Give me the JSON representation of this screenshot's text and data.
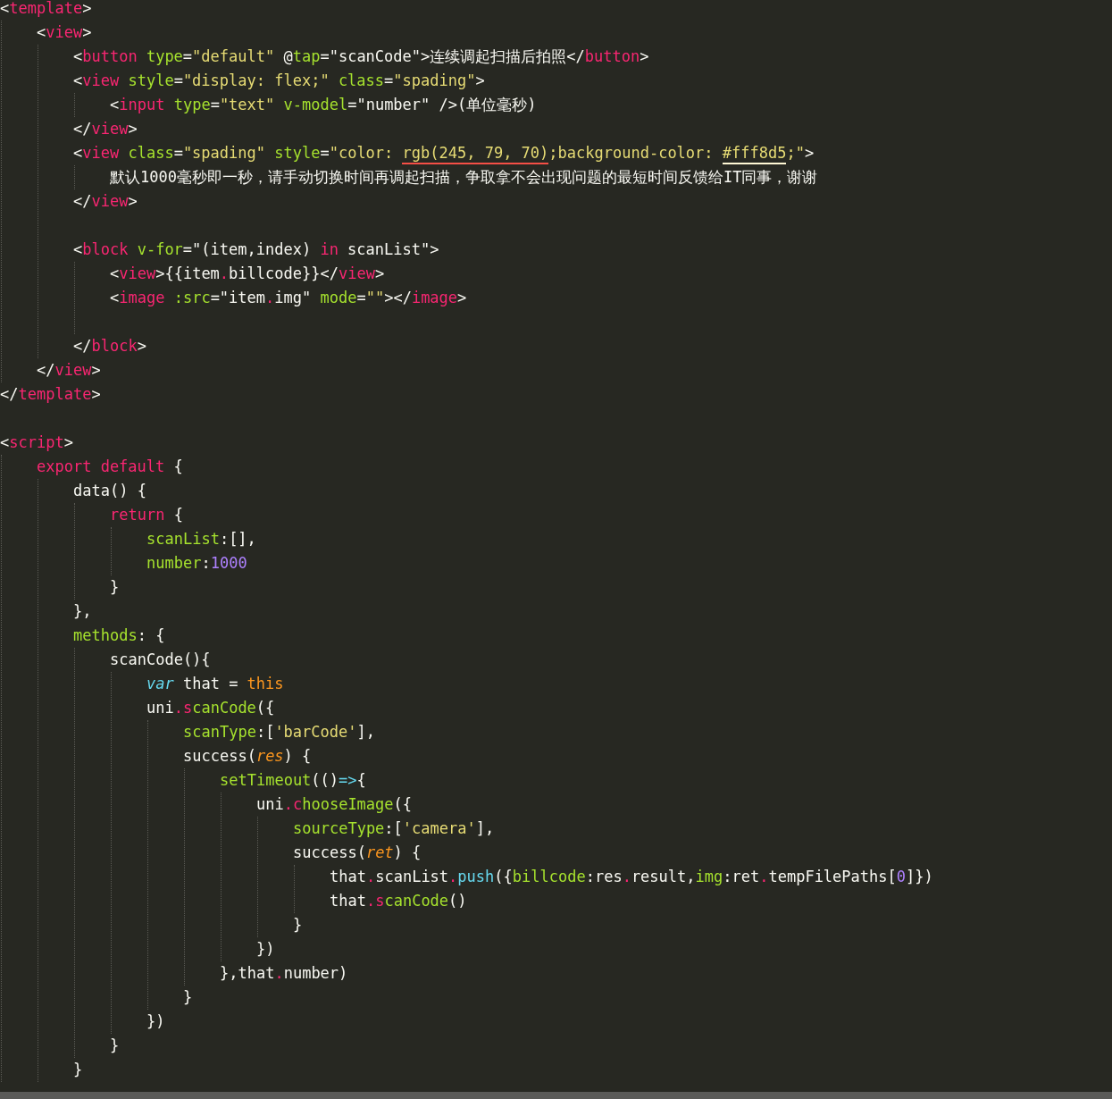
{
  "editor": {
    "lines": [
      {
        "kind": "code",
        "tokens": [
          {
            "kind": "punct",
            "text": "<"
          },
          {
            "kind": "tag",
            "text": "template"
          },
          {
            "kind": "punct",
            "text": ">"
          }
        ],
        "children": [
          {
            "kind": "code",
            "tokens": [
              {
                "kind": "punct",
                "text": "<"
              },
              {
                "kind": "tag",
                "text": "view"
              },
              {
                "kind": "punct",
                "text": ">"
              }
            ],
            "children": [
              {
                "kind": "code",
                "tokens": [
                  {
                    "kind": "punct",
                    "text": "<"
                  },
                  {
                    "kind": "tag",
                    "text": "button"
                  },
                  {
                    "kind": "attr",
                    "text": " type"
                  },
                  {
                    "kind": "punct",
                    "text": "="
                  },
                  {
                    "kind": "string",
                    "text": "\"default\""
                  },
                  {
                    "kind": "punct",
                    "text": " @"
                  },
                  {
                    "kind": "attr",
                    "text": "tap"
                  },
                  {
                    "kind": "punct",
                    "text": "=\"scanCode\">连续调起扫描后拍照</"
                  },
                  {
                    "kind": "tag",
                    "text": "button"
                  },
                  {
                    "kind": "punct",
                    "text": ">"
                  }
                ]
              },
              {
                "kind": "code",
                "tokens": [
                  {
                    "kind": "punct",
                    "text": "<"
                  },
                  {
                    "kind": "tag",
                    "text": "view"
                  },
                  {
                    "kind": "attr",
                    "text": " style"
                  },
                  {
                    "kind": "punct",
                    "text": "="
                  },
                  {
                    "kind": "string",
                    "text": "\"display: flex;\""
                  },
                  {
                    "kind": "attr",
                    "text": " class"
                  },
                  {
                    "kind": "punct",
                    "text": "="
                  },
                  {
                    "kind": "string",
                    "text": "\"spading\""
                  },
                  {
                    "kind": "punct",
                    "text": ">"
                  }
                ],
                "children": [
                  {
                    "kind": "code",
                    "tokens": [
                      {
                        "kind": "punct",
                        "text": "<"
                      },
                      {
                        "kind": "tag",
                        "text": "input"
                      },
                      {
                        "kind": "attr",
                        "text": " type"
                      },
                      {
                        "kind": "punct",
                        "text": "="
                      },
                      {
                        "kind": "string",
                        "text": "\"text\""
                      },
                      {
                        "kind": "attr",
                        "text": " v-model"
                      },
                      {
                        "kind": "punct",
                        "text": "=\"number\" />(单位毫秒)"
                      }
                    ]
                  }
                ]
              },
              {
                "kind": "code",
                "tokens": [
                  {
                    "kind": "punct",
                    "text": "</"
                  },
                  {
                    "kind": "tag",
                    "text": "view"
                  },
                  {
                    "kind": "punct",
                    "text": ">"
                  }
                ]
              },
              {
                "kind": "code",
                "tokens": [
                  {
                    "kind": "punct",
                    "text": "<"
                  },
                  {
                    "kind": "tag",
                    "text": "view"
                  },
                  {
                    "kind": "attr",
                    "text": " class"
                  },
                  {
                    "kind": "punct",
                    "text": "="
                  },
                  {
                    "kind": "string",
                    "text": "\"spading\""
                  },
                  {
                    "kind": "attr",
                    "text": " style"
                  },
                  {
                    "kind": "punct",
                    "text": "="
                  },
                  {
                    "kind": "string",
                    "text": "\"color: "
                  },
                  {
                    "kind": "string",
                    "text": "rgb(245, 79, 70)",
                    "color": "#f54f46"
                  },
                  {
                    "kind": "string",
                    "text": ";background-color: "
                  },
                  {
                    "kind": "string",
                    "text": "#fff8d5",
                    "color": "#fff8d5"
                  },
                  {
                    "kind": "string",
                    "text": ";\""
                  },
                  {
                    "kind": "punct",
                    "text": ">"
                  }
                ],
                "children": [
                  {
                    "kind": "code",
                    "tokens": [
                      {
                        "kind": "punct",
                        "text": "默认1000毫秒即一秒，请手动切换时间再调起扫描，争取拿不会出现问题的最短时间反馈给IT同事，谢谢"
                      }
                    ]
                  }
                ]
              },
              {
                "kind": "code",
                "tokens": [
                  {
                    "kind": "punct",
                    "text": "</"
                  },
                  {
                    "kind": "tag",
                    "text": "view"
                  },
                  {
                    "kind": "punct",
                    "text": ">"
                  }
                ]
              },
              {
                "kind": "blank"
              },
              {
                "kind": "code",
                "tokens": [
                  {
                    "kind": "punct",
                    "text": "<"
                  },
                  {
                    "kind": "tag",
                    "text": "block"
                  },
                  {
                    "kind": "attr",
                    "text": " v-for"
                  },
                  {
                    "kind": "punct",
                    "text": "=\"(item,index) "
                  },
                  {
                    "kind": "keyword",
                    "text": "in"
                  },
                  {
                    "kind": "punct",
                    "text": " scanList\">"
                  }
                ],
                "children": [
                  {
                    "kind": "code",
                    "tokens": [
                      {
                        "kind": "punct",
                        "text": "<"
                      },
                      {
                        "kind": "tag",
                        "text": "view"
                      },
                      {
                        "kind": "punct",
                        "text": ">{{item"
                      },
                      {
                        "kind": "keyword",
                        "text": "."
                      },
                      {
                        "kind": "punct",
                        "text": "billcode}}</"
                      },
                      {
                        "kind": "tag",
                        "text": "view"
                      },
                      {
                        "kind": "punct",
                        "text": ">"
                      }
                    ]
                  },
                  {
                    "kind": "code",
                    "tokens": [
                      {
                        "kind": "punct",
                        "text": "<"
                      },
                      {
                        "kind": "tag",
                        "text": "image"
                      },
                      {
                        "kind": "attr",
                        "text": " :src"
                      },
                      {
                        "kind": "punct",
                        "text": "=\"item"
                      },
                      {
                        "kind": "keyword",
                        "text": "."
                      },
                      {
                        "kind": "punct",
                        "text": "img\""
                      },
                      {
                        "kind": "attr",
                        "text": " mode"
                      },
                      {
                        "kind": "punct",
                        "text": "="
                      },
                      {
                        "kind": "string",
                        "text": "\"\""
                      },
                      {
                        "kind": "punct",
                        "text": "></"
                      },
                      {
                        "kind": "tag",
                        "text": "image"
                      },
                      {
                        "kind": "punct",
                        "text": ">"
                      }
                    ]
                  },
                  {
                    "kind": "blank"
                  }
                ]
              },
              {
                "kind": "code",
                "tokens": [
                  {
                    "kind": "punct",
                    "text": "</"
                  },
                  {
                    "kind": "tag",
                    "text": "block"
                  },
                  {
                    "kind": "punct",
                    "text": ">"
                  }
                ]
              }
            ]
          },
          {
            "kind": "code",
            "tokens": [
              {
                "kind": "punct",
                "text": "</"
              },
              {
                "kind": "tag",
                "text": "view"
              },
              {
                "kind": "punct",
                "text": ">"
              }
            ]
          }
        ]
      },
      {
        "kind": "code",
        "tokens": [
          {
            "kind": "punct",
            "text": "</"
          },
          {
            "kind": "tag",
            "text": "template"
          },
          {
            "kind": "punct",
            "text": ">"
          }
        ]
      },
      {
        "kind": "blank"
      },
      {
        "kind": "code",
        "tokens": [
          {
            "kind": "punct",
            "text": "<"
          },
          {
            "kind": "tag",
            "text": "script"
          },
          {
            "kind": "punct",
            "text": ">"
          }
        ],
        "children": [
          {
            "kind": "code",
            "tokens": [
              {
                "kind": "keyword",
                "text": "export default"
              },
              {
                "kind": "punct",
                "text": " {"
              }
            ],
            "children": [
              {
                "kind": "code",
                "tokens": [
                  {
                    "kind": "punct",
                    "text": "data() {"
                  }
                ],
                "children": [
                  {
                    "kind": "code",
                    "tokens": [
                      {
                        "kind": "keyword",
                        "text": "return"
                      },
                      {
                        "kind": "punct",
                        "text": " {"
                      }
                    ],
                    "children": [
                      {
                        "kind": "code",
                        "tokens": [
                          {
                            "kind": "func",
                            "text": "scanList"
                          },
                          {
                            "kind": "punct",
                            "text": ":[],"
                          }
                        ]
                      },
                      {
                        "kind": "code",
                        "tokens": [
                          {
                            "kind": "func",
                            "text": "number"
                          },
                          {
                            "kind": "punct",
                            "text": ":"
                          },
                          {
                            "kind": "number",
                            "text": "1000"
                          }
                        ]
                      }
                    ]
                  },
                  {
                    "kind": "code",
                    "tokens": [
                      {
                        "kind": "punct",
                        "text": "}"
                      }
                    ]
                  }
                ]
              },
              {
                "kind": "code",
                "tokens": [
                  {
                    "kind": "punct",
                    "text": "},"
                  }
                ]
              },
              {
                "kind": "code",
                "tokens": [
                  {
                    "kind": "func",
                    "text": "methods"
                  },
                  {
                    "kind": "punct",
                    "text": ": {"
                  }
                ],
                "children": [
                  {
                    "kind": "code",
                    "tokens": [
                      {
                        "kind": "punct",
                        "text": "scanCode(){"
                      }
                    ],
                    "children": [
                      {
                        "kind": "code",
                        "tokens": [
                          {
                            "kind": "storage",
                            "text": "var"
                          },
                          {
                            "kind": "punct",
                            "text": " that = "
                          },
                          {
                            "kind": "self",
                            "text": "this"
                          }
                        ]
                      },
                      {
                        "kind": "code",
                        "tokens": [
                          {
                            "kind": "punct",
                            "text": "uni"
                          },
                          {
                            "kind": "method",
                            "text": ".scanCode"
                          },
                          {
                            "kind": "punct",
                            "text": "({"
                          }
                        ],
                        "children": [
                          {
                            "kind": "code",
                            "tokens": [
                              {
                                "kind": "func",
                                "text": "scanType"
                              },
                              {
                                "kind": "punct",
                                "text": ":["
                              },
                              {
                                "kind": "string",
                                "text": "'barCode'"
                              },
                              {
                                "kind": "punct",
                                "text": "],"
                              }
                            ]
                          },
                          {
                            "kind": "code",
                            "tokens": [
                              {
                                "kind": "punct",
                                "text": "success("
                              },
                              {
                                "kind": "param",
                                "text": "res"
                              },
                              {
                                "kind": "punct",
                                "text": ") {"
                              }
                            ],
                            "children": [
                              {
                                "kind": "code",
                                "tokens": [
                                  {
                                    "kind": "func",
                                    "text": "setTimeout"
                                  },
                                  {
                                    "kind": "punct",
                                    "text": "(()"
                                  },
                                  {
                                    "kind": "builtin",
                                    "text": "=>"
                                  },
                                  {
                                    "kind": "punct",
                                    "text": "{"
                                  }
                                ],
                                "children": [
                                  {
                                    "kind": "code",
                                    "tokens": [
                                      {
                                        "kind": "punct",
                                        "text": "uni"
                                      },
                                      {
                                        "kind": "method",
                                        "text": ".chooseImage"
                                      },
                                      {
                                        "kind": "punct",
                                        "text": "({"
                                      }
                                    ],
                                    "children": [
                                      {
                                        "kind": "code",
                                        "tokens": [
                                          {
                                            "kind": "func",
                                            "text": "sourceType"
                                          },
                                          {
                                            "kind": "punct",
                                            "text": ":["
                                          },
                                          {
                                            "kind": "string",
                                            "text": "'camera'"
                                          },
                                          {
                                            "kind": "punct",
                                            "text": "],"
                                          }
                                        ]
                                      },
                                      {
                                        "kind": "code",
                                        "tokens": [
                                          {
                                            "kind": "punct",
                                            "text": "success("
                                          },
                                          {
                                            "kind": "param",
                                            "text": "ret"
                                          },
                                          {
                                            "kind": "punct",
                                            "text": ") {"
                                          }
                                        ],
                                        "children": [
                                          {
                                            "kind": "code",
                                            "tokens": [
                                              {
                                                "kind": "punct",
                                                "text": "that"
                                              },
                                              {
                                                "kind": "keyword",
                                                "text": "."
                                              },
                                              {
                                                "kind": "punct",
                                                "text": "scanList"
                                              },
                                              {
                                                "kind": "keyword",
                                                "text": "."
                                              },
                                              {
                                                "kind": "builtin",
                                                "text": "push"
                                              },
                                              {
                                                "kind": "punct",
                                                "text": "({"
                                              },
                                              {
                                                "kind": "func",
                                                "text": "billcode"
                                              },
                                              {
                                                "kind": "punct",
                                                "text": ":res"
                                              },
                                              {
                                                "kind": "keyword",
                                                "text": "."
                                              },
                                              {
                                                "kind": "punct",
                                                "text": "result,"
                                              },
                                              {
                                                "kind": "func",
                                                "text": "img"
                                              },
                                              {
                                                "kind": "punct",
                                                "text": ":ret"
                                              },
                                              {
                                                "kind": "keyword",
                                                "text": "."
                                              },
                                              {
                                                "kind": "punct",
                                                "text": "tempFilePaths["
                                              },
                                              {
                                                "kind": "number",
                                                "text": "0"
                                              },
                                              {
                                                "kind": "punct",
                                                "text": "]})"
                                              }
                                            ]
                                          },
                                          {
                                            "kind": "code",
                                            "tokens": [
                                              {
                                                "kind": "punct",
                                                "text": "that"
                                              },
                                              {
                                                "kind": "method",
                                                "text": ".scanCode"
                                              },
                                              {
                                                "kind": "punct",
                                                "text": "()"
                                              }
                                            ]
                                          }
                                        ]
                                      },
                                      {
                                        "kind": "code",
                                        "tokens": [
                                          {
                                            "kind": "punct",
                                            "text": "}"
                                          }
                                        ]
                                      }
                                    ]
                                  },
                                  {
                                    "kind": "code",
                                    "tokens": [
                                      {
                                        "kind": "punct",
                                        "text": "})"
                                      }
                                    ]
                                  }
                                ]
                              },
                              {
                                "kind": "code",
                                "tokens": [
                                  {
                                    "kind": "punct",
                                    "text": "},that"
                                  },
                                  {
                                    "kind": "keyword",
                                    "text": "."
                                  },
                                  {
                                    "kind": "punct",
                                    "text": "number)"
                                  }
                                ]
                              }
                            ]
                          },
                          {
                            "kind": "code",
                            "tokens": [
                              {
                                "kind": "punct",
                                "text": "}"
                              }
                            ]
                          }
                        ]
                      },
                      {
                        "kind": "code",
                        "tokens": [
                          {
                            "kind": "punct",
                            "text": "})"
                          }
                        ]
                      }
                    ]
                  },
                  {
                    "kind": "code",
                    "tokens": [
                      {
                        "kind": "punct",
                        "text": "}"
                      }
                    ]
                  }
                ]
              },
              {
                "kind": "code",
                "tokens": [
                  {
                    "kind": "punct",
                    "text": "}"
                  }
                ]
              }
            ]
          }
        ]
      }
    ]
  }
}
